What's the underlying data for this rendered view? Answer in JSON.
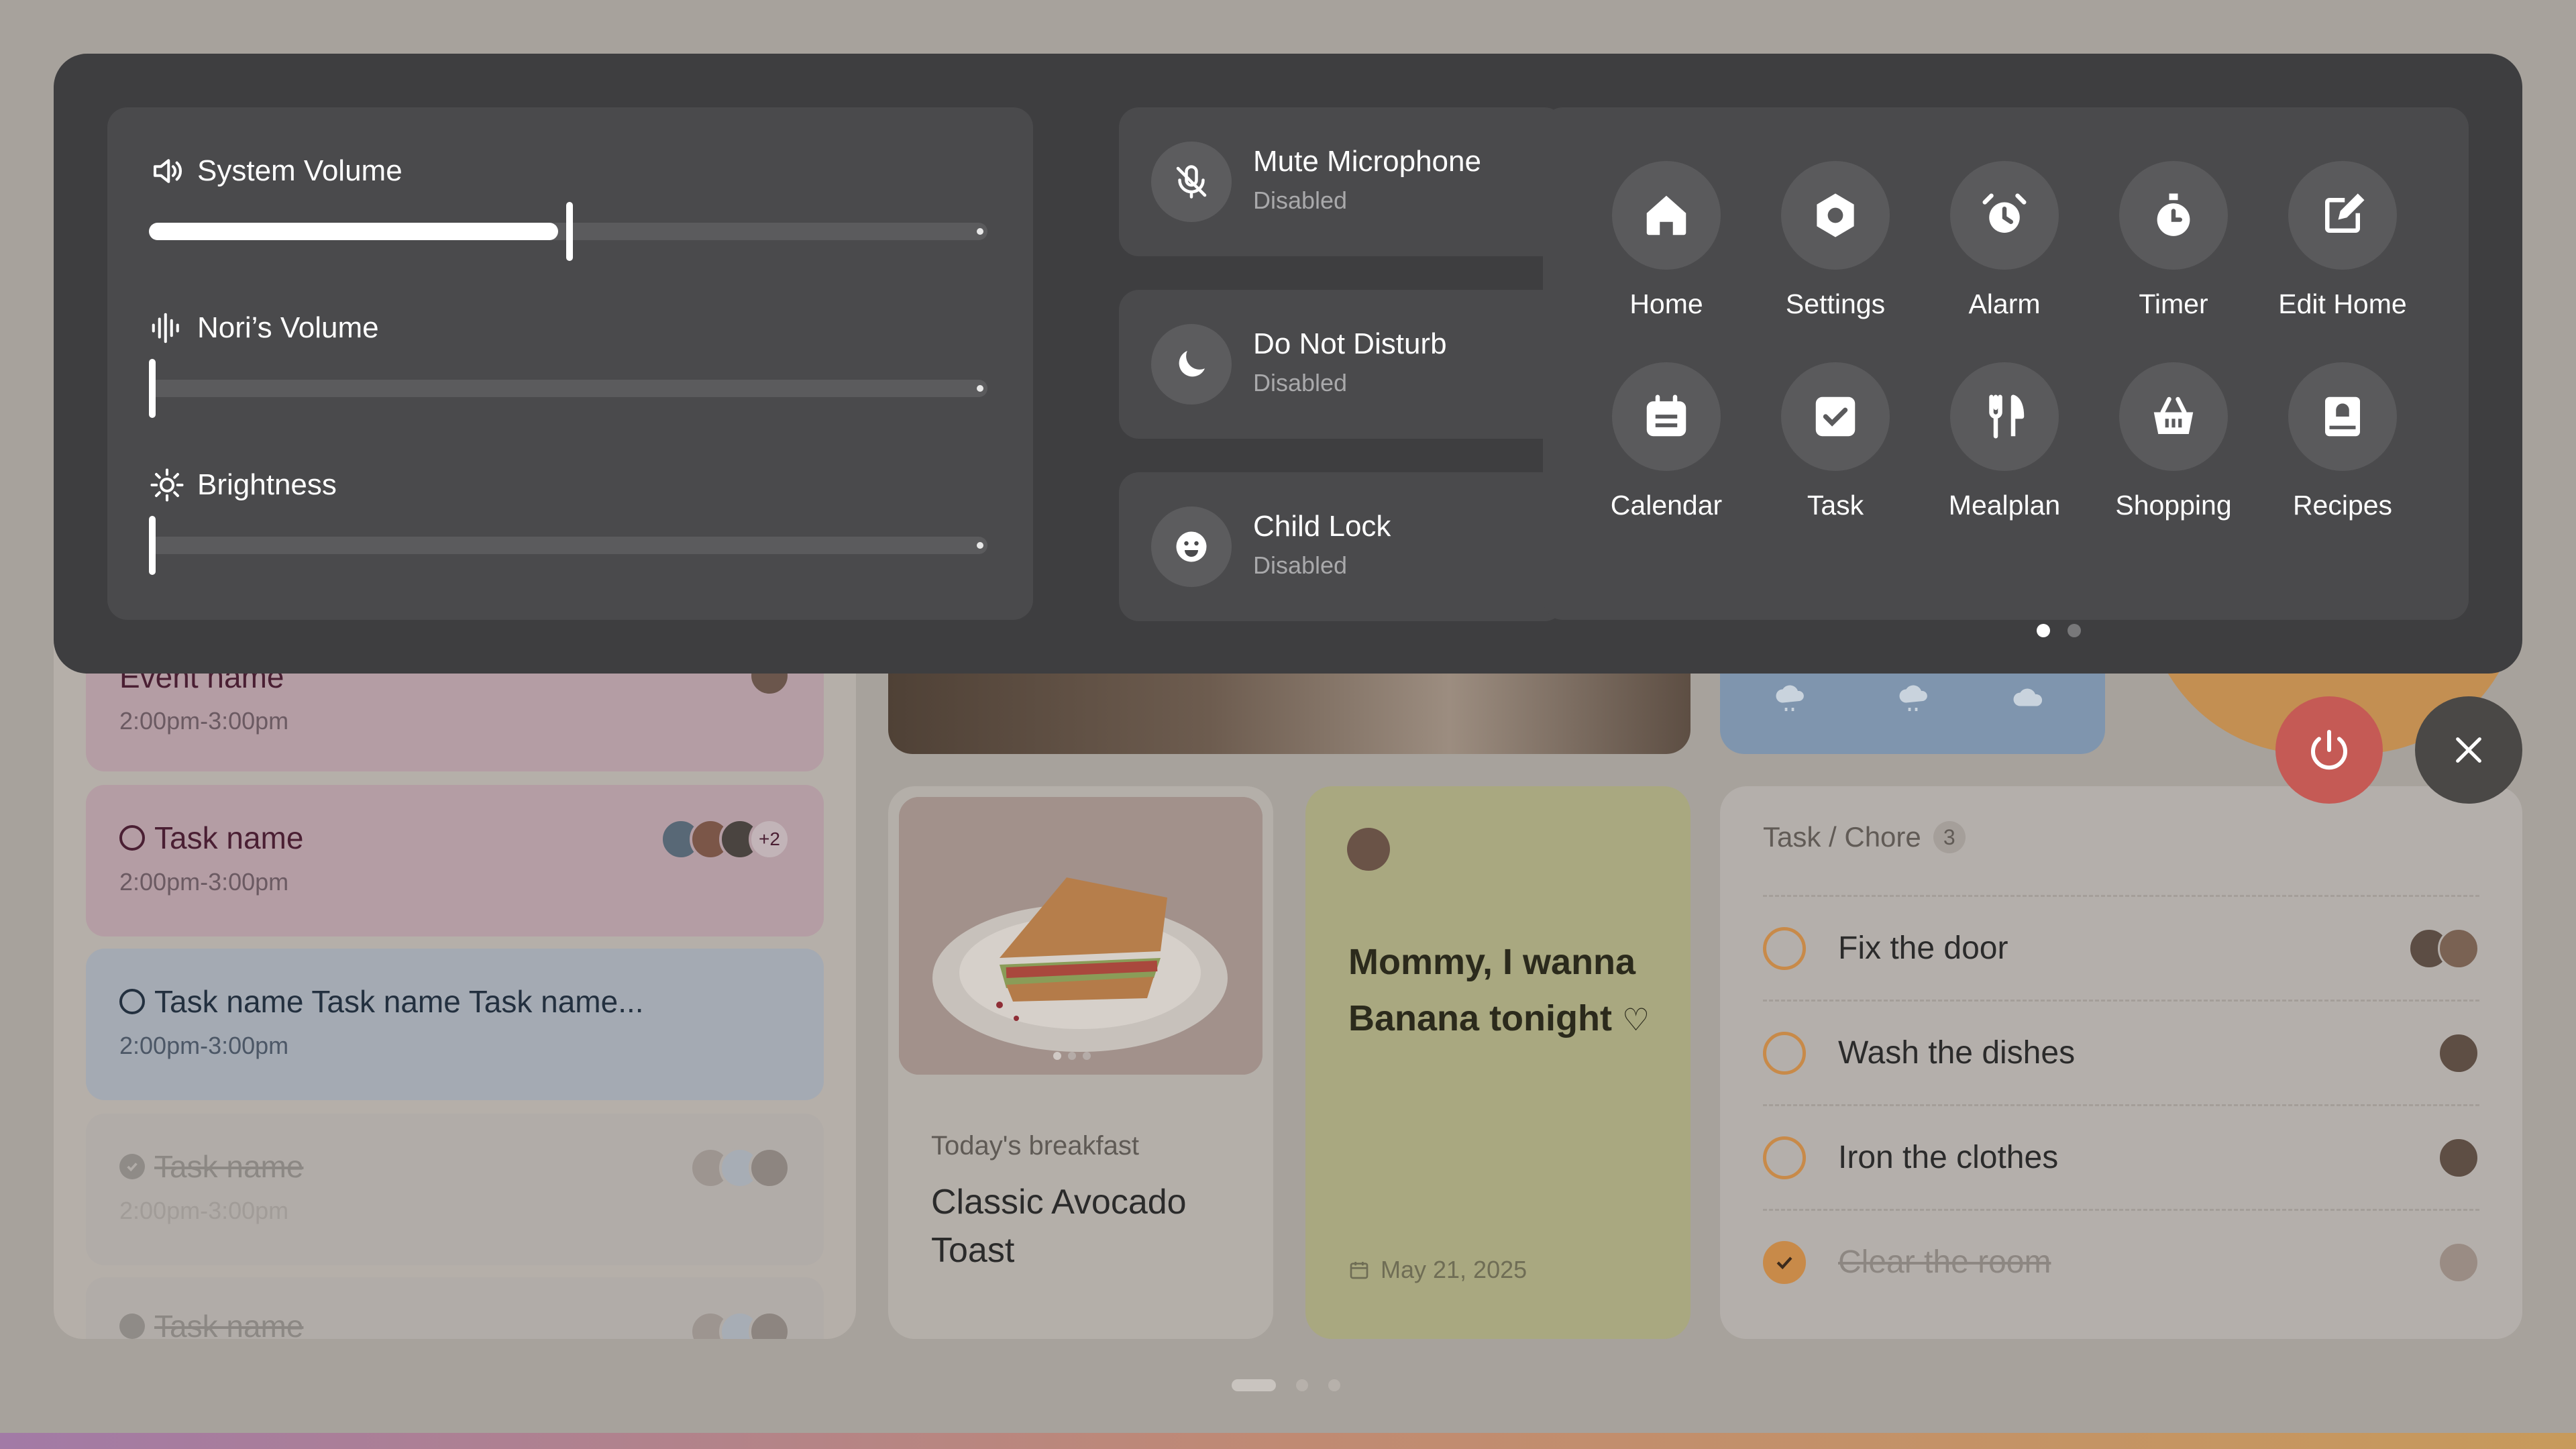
{
  "control_center": {
    "sliders": [
      {
        "label": "System Volume",
        "icon": "speaker-icon",
        "level": 0.5
      },
      {
        "label": "Nori’s Volume",
        "icon": "soundwave-icon",
        "level": 0.0
      },
      {
        "label": "Brightness",
        "icon": "sun-icon",
        "level": 0.0
      }
    ],
    "toggles": [
      {
        "label": "Mute Microphone",
        "status": "Disabled",
        "icon": "mic-off-icon"
      },
      {
        "label": "Do Not Disturb",
        "status": "Disabled",
        "icon": "moon-icon"
      },
      {
        "label": "Child Lock",
        "status": "Disabled",
        "icon": "child-face-icon"
      }
    ],
    "apps": [
      {
        "label": "Home",
        "icon": "home-icon"
      },
      {
        "label": "Settings",
        "icon": "settings-icon"
      },
      {
        "label": "Alarm",
        "icon": "alarm-icon"
      },
      {
        "label": "Timer",
        "icon": "timer-icon"
      },
      {
        "label": "Edit Home",
        "icon": "edit-icon"
      },
      {
        "label": "Calendar",
        "icon": "calendar-icon"
      },
      {
        "label": "Task",
        "icon": "task-icon"
      },
      {
        "label": "Mealplan",
        "icon": "fork-knife-icon"
      },
      {
        "label": "Shopping",
        "icon": "basket-icon"
      },
      {
        "label": "Recipes",
        "icon": "recipe-book-icon"
      }
    ],
    "page_indicator": {
      "pages": 2,
      "current": 1
    }
  },
  "schedule": {
    "items": [
      {
        "title": "Event name",
        "time": "2:00pm-3:00pm",
        "style": "pink",
        "type": "event",
        "extra_avatars": ""
      },
      {
        "title": "Task name",
        "time": "2:00pm-3:00pm",
        "style": "pink",
        "type": "task",
        "extra_avatars": "+2"
      },
      {
        "title": "Task name Task name Task name...",
        "time": "2:00pm-3:00pm",
        "style": "blue",
        "type": "task",
        "extra_avatars": ""
      },
      {
        "title": "Task name",
        "time": "2:00pm-3:00pm",
        "style": "grey",
        "type": "done",
        "extra_avatars": ""
      },
      {
        "title": "Task name",
        "time": "",
        "style": "grey",
        "type": "done",
        "extra_avatars": ""
      }
    ]
  },
  "breakfast": {
    "subtitle": "Today's breakfast",
    "title": "Classic Avocado Toast",
    "image_pages": 3
  },
  "note": {
    "text": "Mommy, I wanna Banana tonight",
    "date": "May 21, 2025"
  },
  "tasks": {
    "header": "Task / Chore",
    "count": "3",
    "items": [
      {
        "label": "Fix the door",
        "done": false
      },
      {
        "label": "Wash the dishes",
        "done": false
      },
      {
        "label": "Iron the clothes",
        "done": false
      },
      {
        "label": "Clear the room",
        "done": true
      }
    ]
  },
  "colors": {
    "panel": "#3e3e40",
    "accent_orange": "#c88a49",
    "power_red": "#c55a55"
  },
  "home_pages": {
    "pages": 3,
    "current": 1
  }
}
